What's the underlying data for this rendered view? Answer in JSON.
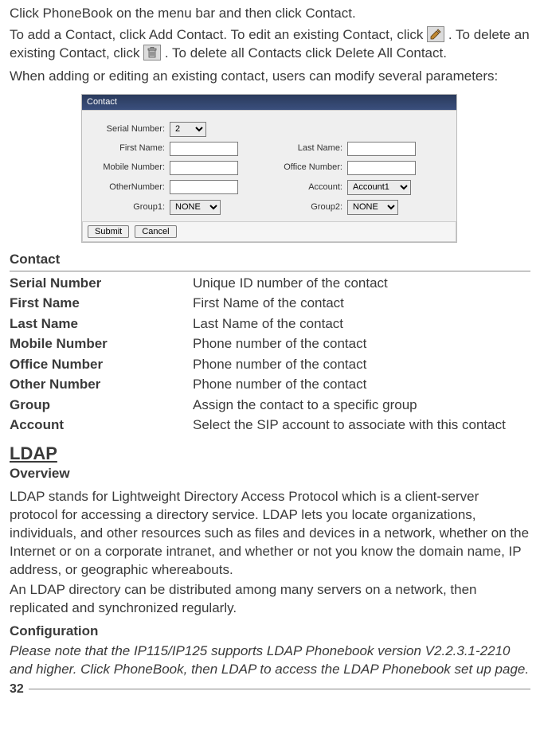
{
  "intro": {
    "line1": "Click PhoneBook on the menu bar and then click Contact.",
    "line2a": "To add a Contact, click Add Contact.  To edit an existing Contact, click ",
    "line2b": " .  To delete an existing Contact, click ",
    "line2c": " .  To delete all Contacts click Delete All Contact.",
    "line3": "When adding or editing an existing contact, users can modify several parameters:"
  },
  "dialog": {
    "title": "Contact",
    "labels": {
      "serial": "Serial Number:",
      "first": "First Name:",
      "last": "Last Name:",
      "mobile": "Mobile Number:",
      "office": "Office Number:",
      "other": "OtherNumber:",
      "account": "Account:",
      "group1": "Group1:",
      "group2": "Group2:"
    },
    "values": {
      "serial": "2",
      "account": "Account1",
      "group1": "NONE",
      "group2": "NONE"
    },
    "buttons": {
      "submit": "Submit",
      "cancel": "Cancel"
    }
  },
  "contact_section": {
    "title": "Contact",
    "defs": [
      {
        "term": "Serial Number",
        "desc": "Unique ID number of the contact"
      },
      {
        "term": "First Name",
        "desc": "First Name of the contact"
      },
      {
        "term": "Last Name",
        "desc": "Last Name of the contact"
      },
      {
        "term": "Mobile Number",
        "desc": "Phone number of the contact"
      },
      {
        "term": "Office Number",
        "desc": "Phone number of the contact"
      },
      {
        "term": "Other Number",
        "desc": "Phone number of the contact"
      },
      {
        "term": "Group",
        "desc": "Assign the contact to a specific group"
      },
      {
        "term": "Account",
        "desc": "Select the SIP account to associate with this contact"
      }
    ]
  },
  "ldap": {
    "title": "LDAP",
    "overview_label": "Overview",
    "p1": "LDAP stands for Lightweight Directory Access Protocol which is a client-server protocol for accessing a directory service. LDAP lets you locate organizations, individuals, and other resources such as files and devices in a network, whether on the Internet or on a corporate intranet, and whether or not you know the domain name, IP address, or geographic whereabouts.",
    "p2": "An LDAP directory can be distributed among many servers on a network, then replicated and synchronized regularly.",
    "config_label": "Configuration",
    "note": "Please note that the IP115/IP125 supports LDAP Phonebook version V2.2.3.1-2210 and higher.  Click PhoneBook, then LDAP to access the LDAP Phonebook set up page."
  },
  "page_number": "32"
}
